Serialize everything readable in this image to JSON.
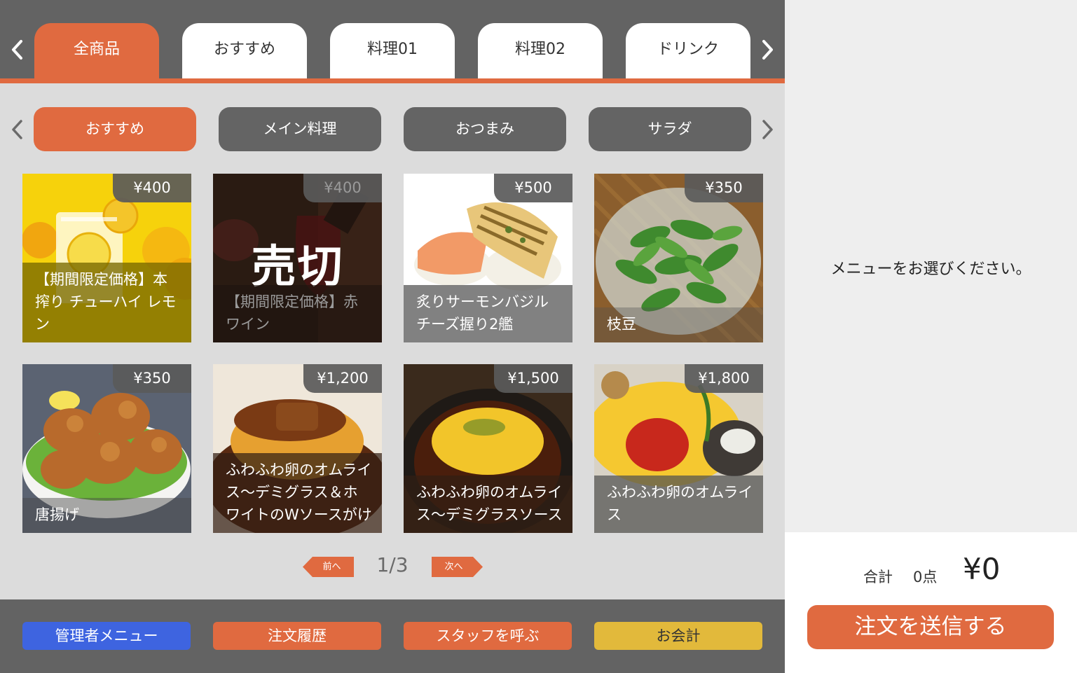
{
  "top_tabs": [
    {
      "label": "全商品",
      "active": true
    },
    {
      "label": "おすすめ",
      "active": false
    },
    {
      "label": "料理01",
      "active": false
    },
    {
      "label": "料理02",
      "active": false
    },
    {
      "label": "ドリンク",
      "active": false
    }
  ],
  "sub_tabs": [
    {
      "label": "おすすめ",
      "active": true
    },
    {
      "label": "メイン料理",
      "active": false
    },
    {
      "label": "おつまみ",
      "active": false
    },
    {
      "label": "サラダ",
      "active": false
    }
  ],
  "products": [
    {
      "price": "¥400",
      "name": "【期間限定価格】本搾り チューハイ レモン",
      "sold_out": false
    },
    {
      "price": "¥400",
      "name": "【期間限定価格】赤ワイン",
      "sold_out": true,
      "sold_out_label": "売切"
    },
    {
      "price": "¥500",
      "name": "炙りサーモンバジルチーズ握り2艦",
      "sold_out": false
    },
    {
      "price": "¥350",
      "name": "枝豆",
      "sold_out": false
    },
    {
      "price": "¥350",
      "name": "唐揚げ",
      "sold_out": false
    },
    {
      "price": "¥1,200",
      "name": "ふわふわ卵のオムライス～デミグラス＆ホワイトのWソースがけ",
      "sold_out": false
    },
    {
      "price": "¥1,500",
      "name": "ふわふわ卵のオムライス～デミグラスソース",
      "sold_out": false
    },
    {
      "price": "¥1,800",
      "name": "ふわふわ卵のオムライス",
      "sold_out": false
    }
  ],
  "pagination": {
    "prev_label": "前へ",
    "next_label": "次へ",
    "indicator": "1/3"
  },
  "bottom_buttons": [
    {
      "label": "管理者メニュー",
      "color": "#3e64e0"
    },
    {
      "label": "注文履歴",
      "color": "#e06a40"
    },
    {
      "label": "スタッフを呼ぶ",
      "color": "#e06a40"
    },
    {
      "label": "お会計",
      "color": "#e2b93b"
    }
  ],
  "order_panel": {
    "empty_message": "メニューをお選びください。",
    "total_label": "合計",
    "item_count": "0点",
    "total_amount": "¥0",
    "send_label": "注文を送信する"
  },
  "colors": {
    "accent": "#e06a40",
    "bar": "#636363",
    "sub_tab": "#646464"
  },
  "icons": [
    "chevron-left-icon",
    "chevron-right-icon"
  ]
}
